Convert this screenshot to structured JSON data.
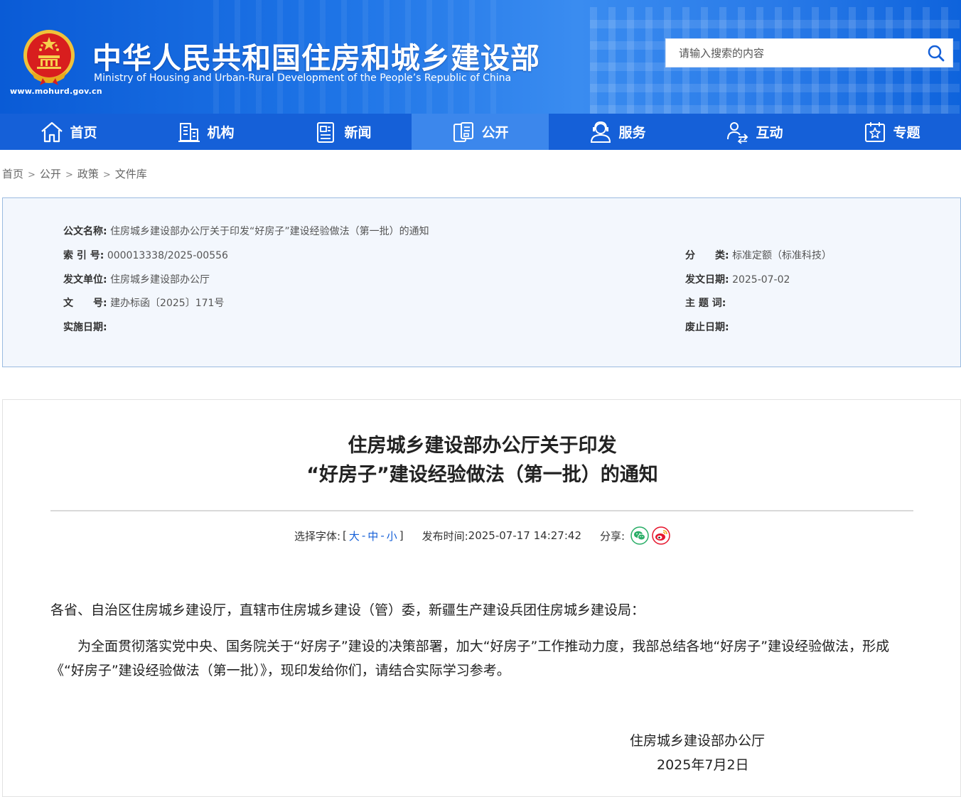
{
  "header": {
    "site_url": "www.mohurd.gov.cn",
    "title_cn": "中华人民共和国住房和城乡建设部",
    "title_en": "Ministry of Housing and Urban-Rural Development of the People’s Republic of China",
    "search_placeholder": "请输入搜索的内容"
  },
  "nav": {
    "items": [
      {
        "label": "首页",
        "icon": "home-icon"
      },
      {
        "label": "机构",
        "icon": "building-icon"
      },
      {
        "label": "新闻",
        "icon": "news-icon"
      },
      {
        "label": "公开",
        "icon": "open-icon",
        "active": true
      },
      {
        "label": "服务",
        "icon": "service-icon"
      },
      {
        "label": "互动",
        "icon": "interact-icon"
      },
      {
        "label": "专题",
        "icon": "topic-icon"
      }
    ]
  },
  "breadcrumb": [
    "首页",
    "公开",
    "政策",
    "文件库"
  ],
  "breadcrumb_sep": ">",
  "info": {
    "doc_name_label": "公文名称:",
    "doc_name": "住房城乡建设部办公厅关于印发“好房子”建设经验做法（第一批）的通知",
    "index_label": "索 引 号:",
    "index": "000013338/2025-00556",
    "category_label": "分　　类:",
    "category": "标准定额（标准科技）",
    "issuer_label": "发文单位:",
    "issuer": "住房城乡建设部办公厅",
    "issue_date_label": "发文日期:",
    "issue_date": "2025-07-02",
    "doc_no_label": "文　　号:",
    "doc_no": "建办标函〔2025〕171号",
    "keywords_label": "主 题 词:",
    "keywords": "",
    "effective_label": "实施日期:",
    "effective": "",
    "expire_label": "废止日期:",
    "expire": ""
  },
  "article": {
    "title_line1": "住房城乡建设部办公厅关于印发",
    "title_line2": "“好房子”建设经验做法（第一批）的通知",
    "font_label": "选择字体:",
    "bracket_open": "[",
    "bracket_close": "]",
    "font_large": "大",
    "font_medium": "中",
    "font_small": "小",
    "font_sep": "-",
    "publish_label": "发布时间:",
    "publish_time": "2025-07-17 14:27:42",
    "share_label": "分享:",
    "salutation": "各省、自治区住房城乡建设厅，直辖市住房城乡建设（管）委，新疆生产建设兵团住房城乡建设局：",
    "paragraph1": "为全面贯彻落实党中央、国务院关于“好房子”建设的决策部署，加大“好房子”工作推动力度，我部总结各地“好房子”建设经验做法，形成《“好房子”建设经验做法（第一批）》，现印发给你们，请结合实际学习参考。",
    "signature": "住房城乡建设部办公厅",
    "sign_date": "2025年7月2日"
  },
  "colors": {
    "nav_bg": "#1560d8",
    "nav_active": "#3c87ec",
    "link_blue": "#1560d8",
    "panel_bg": "#f3f7fd",
    "wechat_green": "#2aae67",
    "weibo_red": "#e6162d"
  }
}
